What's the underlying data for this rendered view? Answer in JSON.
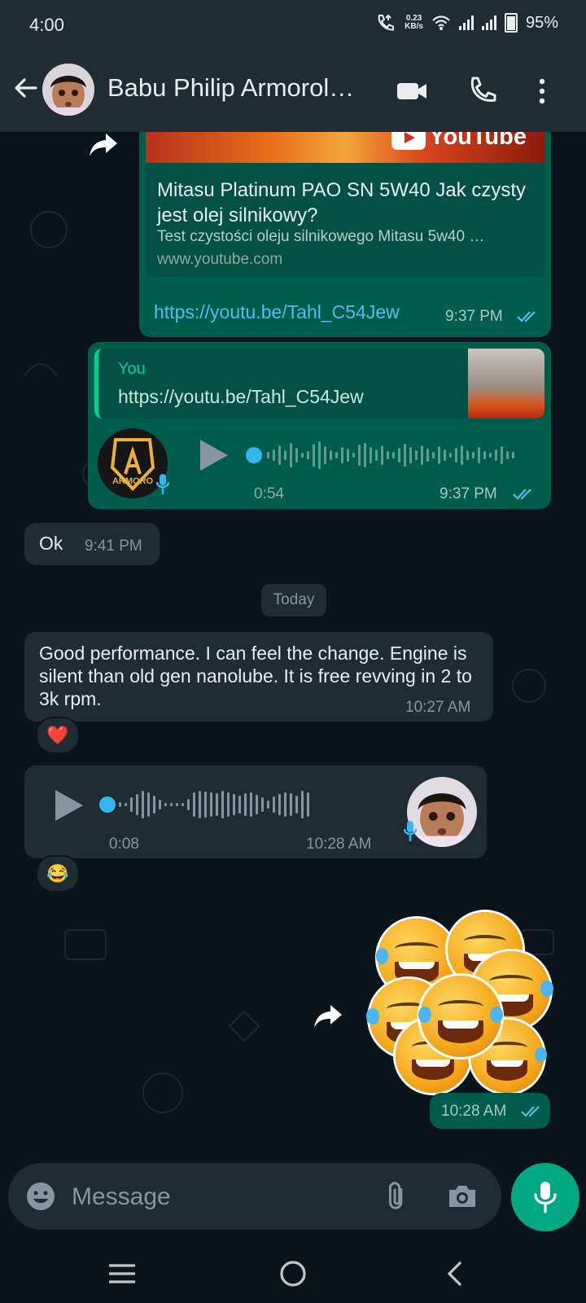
{
  "status_bar": {
    "time": "4:00",
    "network_speed": "0.23",
    "network_speed_unit": "KB/s",
    "battery": "95%"
  },
  "header": {
    "contact_name": "Babu Philip Armorol…"
  },
  "messages": {
    "link_msg": {
      "preview_title": "Mitasu Platinum PAO SN 5W40 Jak czysty jest olej silnikowy?",
      "preview_desc": "Test czystości oleju silnikowego Mitasu 5w40 …",
      "preview_site": "www.youtube.com",
      "youtube_label": "YouTube",
      "link": "https://youtu.be/Tahl_C54Jew",
      "time": "9:37 PM"
    },
    "voice_reply": {
      "quote_author": "You",
      "quote_text": "https://youtu.be/Tahl_C54Jew",
      "avatar_text": "ARMORO",
      "duration": "0:54",
      "time": "9:37 PM"
    },
    "ok_msg": {
      "text": "Ok",
      "time": "9:41 PM"
    },
    "date_chip": "Today",
    "performance_msg": {
      "text": "Good performance. I can feel the change. Engine is silent than old gen nanolube. It is free revving in 2 to 3k rpm.",
      "time": "10:27 AM",
      "reaction": "❤️"
    },
    "incoming_voice": {
      "duration": "0:08",
      "time": "10:28 AM",
      "reaction": "😂"
    },
    "sticker_msg": {
      "time": "10:28 AM"
    }
  },
  "composer": {
    "placeholder": "Message"
  },
  "colors": {
    "outgoing_bubble": "#005c4b",
    "incoming_bubble": "#1f2c34",
    "background": "#0b141a",
    "accent": "#00a884",
    "link": "#53bdeb",
    "read_ticks": "#53bdeb"
  },
  "icons": {
    "header": [
      "back-arrow-icon",
      "video-call-icon",
      "phone-icon",
      "more-icon"
    ],
    "composer": [
      "emoji-icon",
      "attach-icon",
      "camera-icon",
      "mic-icon"
    ],
    "nav": [
      "recents-icon",
      "home-icon",
      "back-icon"
    ]
  }
}
